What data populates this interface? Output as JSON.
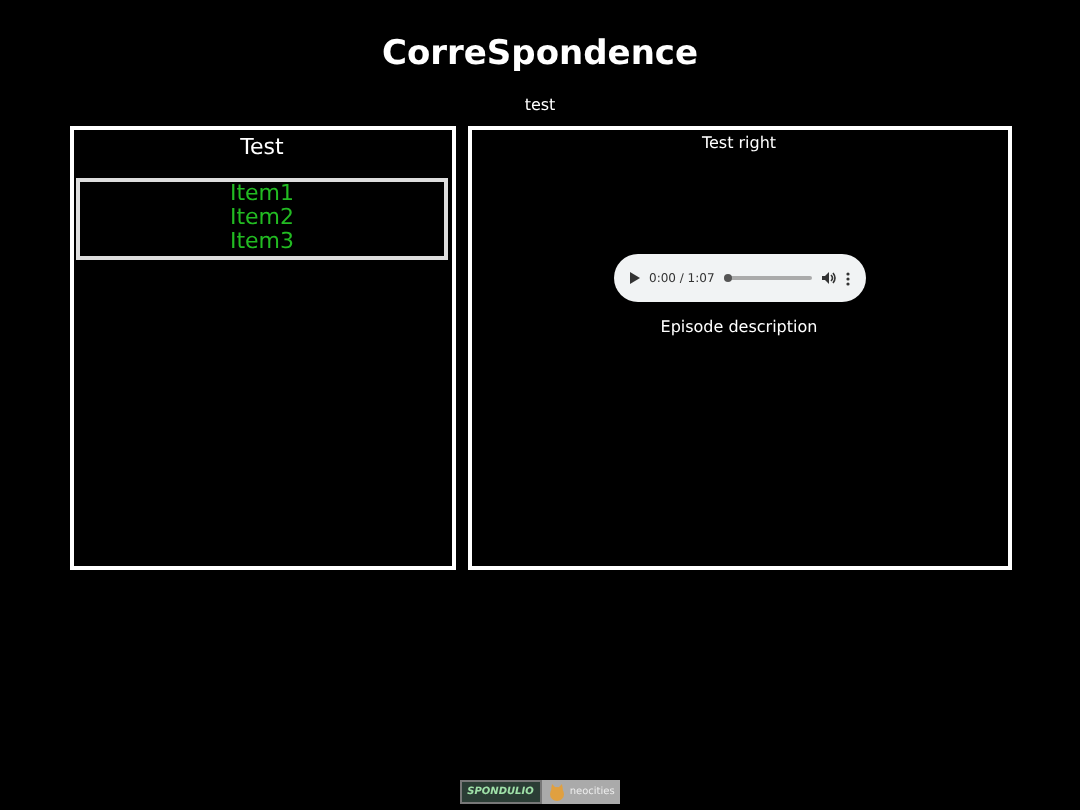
{
  "header": {
    "title": "CorreSpondence",
    "subtitle": "test"
  },
  "left_panel": {
    "title": "Test",
    "items": [
      "Item1",
      "Item2",
      "Item3"
    ]
  },
  "right_panel": {
    "title": "Test right",
    "audio": {
      "time": "0:00 / 1:07",
      "level": 0
    },
    "description": "Episode description"
  },
  "footer": {
    "badge_left": "SPONDULIO",
    "badge_right": "neocities"
  }
}
